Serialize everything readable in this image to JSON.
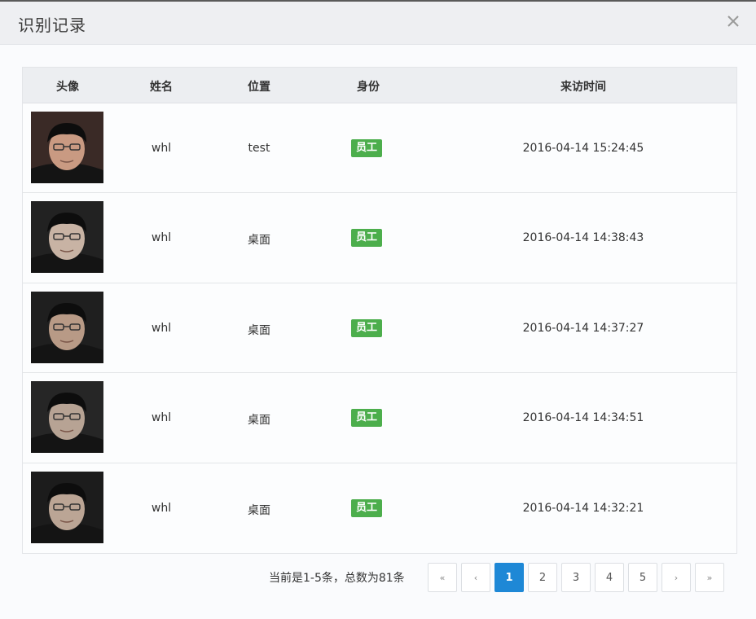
{
  "dialog": {
    "title": "识别记录",
    "close_label": "×"
  },
  "table": {
    "columns": [
      "头像",
      "姓名",
      "位置",
      "身份",
      "来访时间"
    ],
    "rows": [
      {
        "name": "whl",
        "location": "test",
        "role": "员工",
        "time": "2016-04-14 15:24:45"
      },
      {
        "name": "whl",
        "location": "桌面",
        "role": "员工",
        "time": "2016-04-14 14:38:43"
      },
      {
        "name": "whl",
        "location": "桌面",
        "role": "员工",
        "time": "2016-04-14 14:37:27"
      },
      {
        "name": "whl",
        "location": "桌面",
        "role": "员工",
        "time": "2016-04-14 14:34:51"
      },
      {
        "name": "whl",
        "location": "桌面",
        "role": "员工",
        "time": "2016-04-14 14:32:21"
      }
    ]
  },
  "pagination": {
    "info": "当前是1-5条，总数为81条",
    "first": "«",
    "prev": "‹",
    "pages": [
      "1",
      "2",
      "3",
      "4",
      "5"
    ],
    "active_page": "1",
    "next": "›",
    "last": "»"
  },
  "colors": {
    "badge": "#4cae4c",
    "active_page": "#1e88d6"
  }
}
